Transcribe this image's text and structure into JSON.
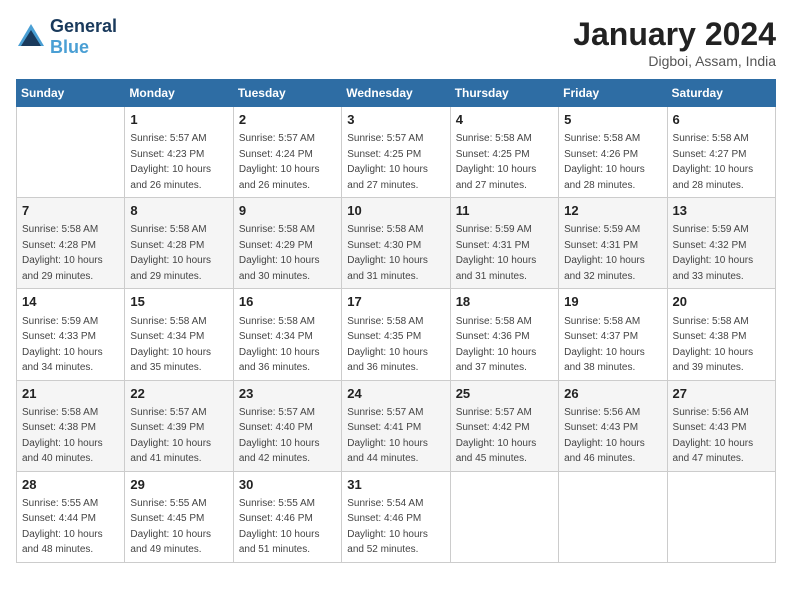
{
  "header": {
    "logo_line1": "General",
    "logo_line2": "Blue",
    "month": "January 2024",
    "location": "Digboi, Assam, India"
  },
  "days_of_week": [
    "Sunday",
    "Monday",
    "Tuesday",
    "Wednesday",
    "Thursday",
    "Friday",
    "Saturday"
  ],
  "weeks": [
    [
      {
        "day": "",
        "sunrise": "",
        "sunset": "",
        "daylight": ""
      },
      {
        "day": "1",
        "sunrise": "Sunrise: 5:57 AM",
        "sunset": "Sunset: 4:23 PM",
        "daylight": "Daylight: 10 hours and 26 minutes."
      },
      {
        "day": "2",
        "sunrise": "Sunrise: 5:57 AM",
        "sunset": "Sunset: 4:24 PM",
        "daylight": "Daylight: 10 hours and 26 minutes."
      },
      {
        "day": "3",
        "sunrise": "Sunrise: 5:57 AM",
        "sunset": "Sunset: 4:25 PM",
        "daylight": "Daylight: 10 hours and 27 minutes."
      },
      {
        "day": "4",
        "sunrise": "Sunrise: 5:58 AM",
        "sunset": "Sunset: 4:25 PM",
        "daylight": "Daylight: 10 hours and 27 minutes."
      },
      {
        "day": "5",
        "sunrise": "Sunrise: 5:58 AM",
        "sunset": "Sunset: 4:26 PM",
        "daylight": "Daylight: 10 hours and 28 minutes."
      },
      {
        "day": "6",
        "sunrise": "Sunrise: 5:58 AM",
        "sunset": "Sunset: 4:27 PM",
        "daylight": "Daylight: 10 hours and 28 minutes."
      }
    ],
    [
      {
        "day": "7",
        "sunrise": "Sunrise: 5:58 AM",
        "sunset": "Sunset: 4:28 PM",
        "daylight": "Daylight: 10 hours and 29 minutes."
      },
      {
        "day": "8",
        "sunrise": "Sunrise: 5:58 AM",
        "sunset": "Sunset: 4:28 PM",
        "daylight": "Daylight: 10 hours and 29 minutes."
      },
      {
        "day": "9",
        "sunrise": "Sunrise: 5:58 AM",
        "sunset": "Sunset: 4:29 PM",
        "daylight": "Daylight: 10 hours and 30 minutes."
      },
      {
        "day": "10",
        "sunrise": "Sunrise: 5:58 AM",
        "sunset": "Sunset: 4:30 PM",
        "daylight": "Daylight: 10 hours and 31 minutes."
      },
      {
        "day": "11",
        "sunrise": "Sunrise: 5:59 AM",
        "sunset": "Sunset: 4:31 PM",
        "daylight": "Daylight: 10 hours and 31 minutes."
      },
      {
        "day": "12",
        "sunrise": "Sunrise: 5:59 AM",
        "sunset": "Sunset: 4:31 PM",
        "daylight": "Daylight: 10 hours and 32 minutes."
      },
      {
        "day": "13",
        "sunrise": "Sunrise: 5:59 AM",
        "sunset": "Sunset: 4:32 PM",
        "daylight": "Daylight: 10 hours and 33 minutes."
      }
    ],
    [
      {
        "day": "14",
        "sunrise": "Sunrise: 5:59 AM",
        "sunset": "Sunset: 4:33 PM",
        "daylight": "Daylight: 10 hours and 34 minutes."
      },
      {
        "day": "15",
        "sunrise": "Sunrise: 5:58 AM",
        "sunset": "Sunset: 4:34 PM",
        "daylight": "Daylight: 10 hours and 35 minutes."
      },
      {
        "day": "16",
        "sunrise": "Sunrise: 5:58 AM",
        "sunset": "Sunset: 4:34 PM",
        "daylight": "Daylight: 10 hours and 36 minutes."
      },
      {
        "day": "17",
        "sunrise": "Sunrise: 5:58 AM",
        "sunset": "Sunset: 4:35 PM",
        "daylight": "Daylight: 10 hours and 36 minutes."
      },
      {
        "day": "18",
        "sunrise": "Sunrise: 5:58 AM",
        "sunset": "Sunset: 4:36 PM",
        "daylight": "Daylight: 10 hours and 37 minutes."
      },
      {
        "day": "19",
        "sunrise": "Sunrise: 5:58 AM",
        "sunset": "Sunset: 4:37 PM",
        "daylight": "Daylight: 10 hours and 38 minutes."
      },
      {
        "day": "20",
        "sunrise": "Sunrise: 5:58 AM",
        "sunset": "Sunset: 4:38 PM",
        "daylight": "Daylight: 10 hours and 39 minutes."
      }
    ],
    [
      {
        "day": "21",
        "sunrise": "Sunrise: 5:58 AM",
        "sunset": "Sunset: 4:38 PM",
        "daylight": "Daylight: 10 hours and 40 minutes."
      },
      {
        "day": "22",
        "sunrise": "Sunrise: 5:57 AM",
        "sunset": "Sunset: 4:39 PM",
        "daylight": "Daylight: 10 hours and 41 minutes."
      },
      {
        "day": "23",
        "sunrise": "Sunrise: 5:57 AM",
        "sunset": "Sunset: 4:40 PM",
        "daylight": "Daylight: 10 hours and 42 minutes."
      },
      {
        "day": "24",
        "sunrise": "Sunrise: 5:57 AM",
        "sunset": "Sunset: 4:41 PM",
        "daylight": "Daylight: 10 hours and 44 minutes."
      },
      {
        "day": "25",
        "sunrise": "Sunrise: 5:57 AM",
        "sunset": "Sunset: 4:42 PM",
        "daylight": "Daylight: 10 hours and 45 minutes."
      },
      {
        "day": "26",
        "sunrise": "Sunrise: 5:56 AM",
        "sunset": "Sunset: 4:43 PM",
        "daylight": "Daylight: 10 hours and 46 minutes."
      },
      {
        "day": "27",
        "sunrise": "Sunrise: 5:56 AM",
        "sunset": "Sunset: 4:43 PM",
        "daylight": "Daylight: 10 hours and 47 minutes."
      }
    ],
    [
      {
        "day": "28",
        "sunrise": "Sunrise: 5:55 AM",
        "sunset": "Sunset: 4:44 PM",
        "daylight": "Daylight: 10 hours and 48 minutes."
      },
      {
        "day": "29",
        "sunrise": "Sunrise: 5:55 AM",
        "sunset": "Sunset: 4:45 PM",
        "daylight": "Daylight: 10 hours and 49 minutes."
      },
      {
        "day": "30",
        "sunrise": "Sunrise: 5:55 AM",
        "sunset": "Sunset: 4:46 PM",
        "daylight": "Daylight: 10 hours and 51 minutes."
      },
      {
        "day": "31",
        "sunrise": "Sunrise: 5:54 AM",
        "sunset": "Sunset: 4:46 PM",
        "daylight": "Daylight: 10 hours and 52 minutes."
      },
      {
        "day": "",
        "sunrise": "",
        "sunset": "",
        "daylight": ""
      },
      {
        "day": "",
        "sunrise": "",
        "sunset": "",
        "daylight": ""
      },
      {
        "day": "",
        "sunrise": "",
        "sunset": "",
        "daylight": ""
      }
    ]
  ]
}
